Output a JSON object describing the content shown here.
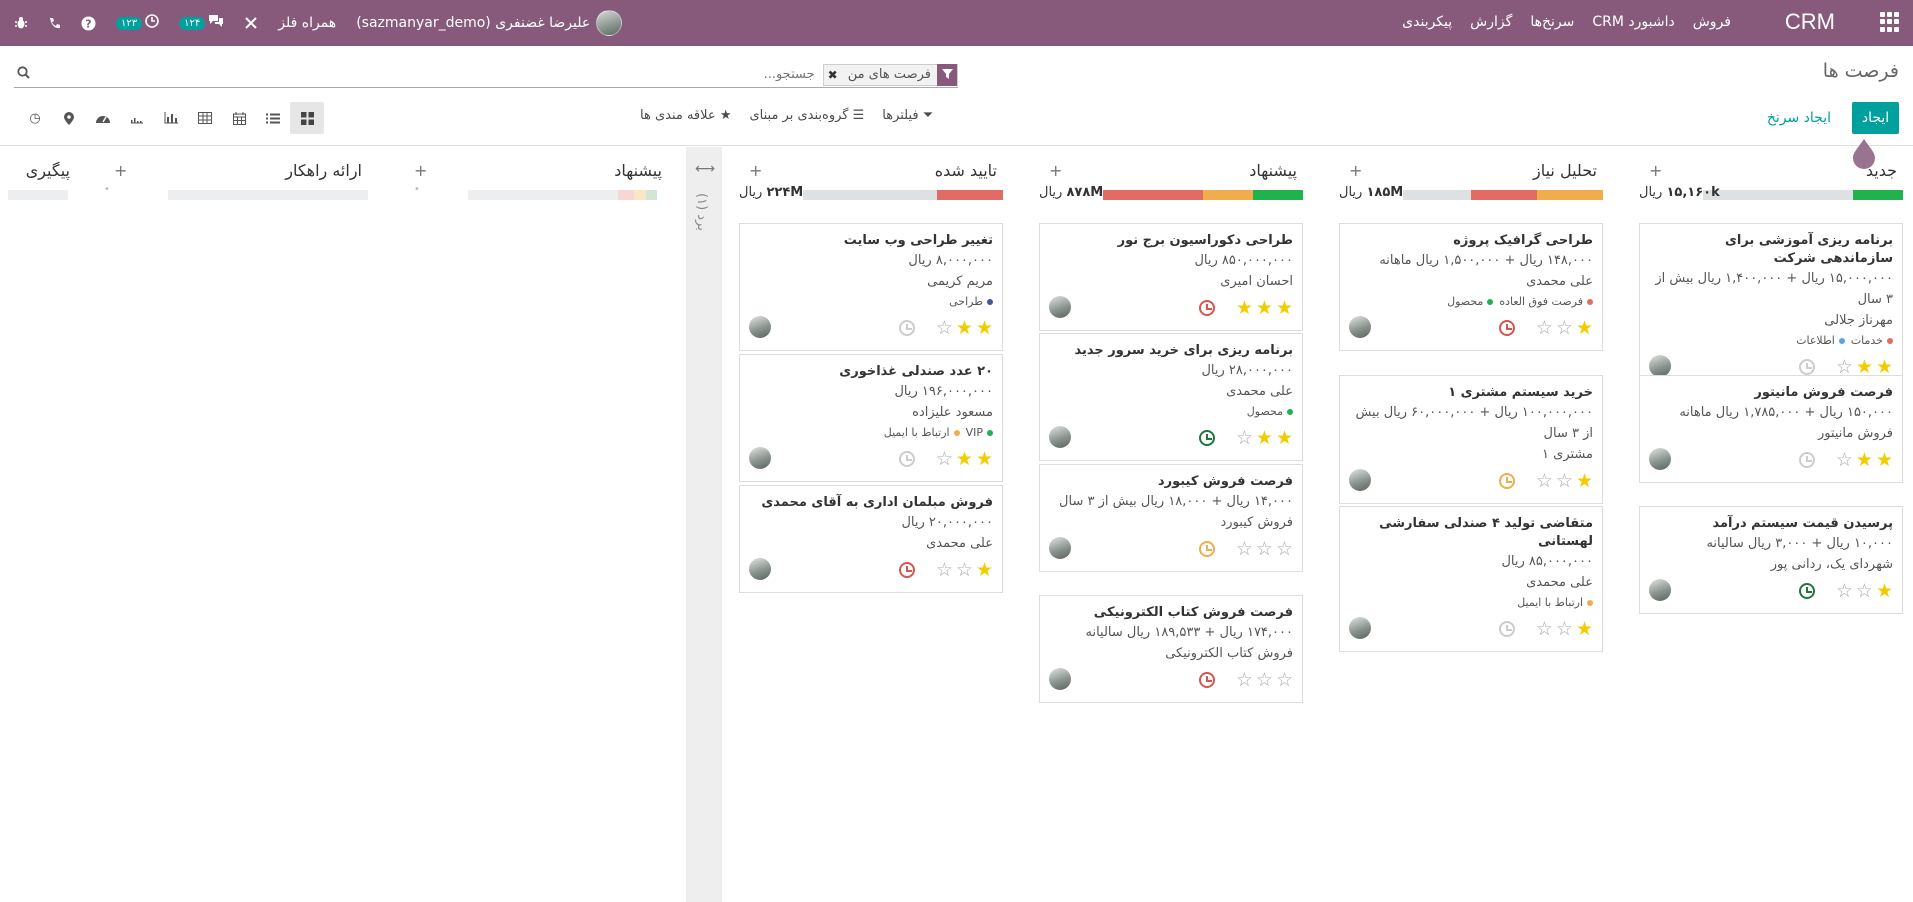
{
  "navbar": {
    "brand": "CRM",
    "menu": [
      "فروش",
      "داشبورد CRM",
      "سرنخ‌ها",
      "گزارش",
      "پیکربندی"
    ],
    "user": "علیرضا غضنفری (sazmanyar_demo)",
    "company": "همراه فلز",
    "messages_badge": "۱۲۴",
    "activities_badge": "۱۲۳"
  },
  "control": {
    "title": "فرصت ها",
    "facet": "فرصت های من",
    "search_placeholder": "جستجو...",
    "create": "ایجاد",
    "quick_create": "ایجاد سرنخ",
    "filters": "فیلترها",
    "group_by": "گروه‌بندی بر مبنای",
    "favorites": "علاقه مندی ها"
  },
  "colors": {
    "brand": "#875a7b",
    "accent": "#00a09d",
    "green": "#21b14d",
    "orange": "#f0ad4e",
    "red": "#e06c63",
    "grey": "#dde1e4"
  },
  "columns": [
    {
      "title": "جدید",
      "total_value": "۱۵,۱۶۰k",
      "total_unit": "ریال",
      "progress": {
        "green": 25,
        "orange": 0,
        "red": 0,
        "grey": 75
      },
      "cards": [
        {
          "title": "برنامه ریزی آموزشی برای سازماندهی شرکت",
          "lines": [
            "۱۵,۰۰۰,۰۰۰ ریال + ۱,۴۰۰,۰۰۰ ریال بیش از ۳ سال",
            "مهرناز جلالی"
          ],
          "tags": [
            {
              "label": "خدمات",
              "color": "#e06c63"
            },
            {
              "label": "اطلاعات",
              "color": "#5aa6dc"
            }
          ],
          "stars": 2,
          "clock": "#cccccc"
        },
        {
          "title": "فرصت فروش مانیتور",
          "lines": [
            "۱۵۰,۰۰۰ ریال + ۱,۷۸۵,۰۰۰ ریال ماهانه",
            "فروش مانیتور"
          ],
          "tags": [],
          "stars": 2,
          "clock": "#cccccc"
        },
        {
          "title": "پرسیدن قیمت سیستم درآمد",
          "lines": [
            "۱۰,۰۰۰ ریال + ۳,۰۰۰ ریال سالیانه",
            "شهردای یک، ردانی پور"
          ],
          "tags": [],
          "stars": 1,
          "clock": "#21763a"
        }
      ]
    },
    {
      "title": "تحلیل نیاز",
      "total_value": "۱۸۵M",
      "total_unit": "ریال",
      "progress": {
        "green": 0,
        "orange": 33,
        "red": 33,
        "grey": 34
      },
      "cards": [
        {
          "title": "طراحی گرافیک پروژه",
          "lines": [
            "۱۴۸,۰۰۰ ریال + ۱,۵۰۰,۰۰۰ ریال ماهانه",
            "علی محمدی"
          ],
          "tags": [
            {
              "label": "فرصت فوق العاده",
              "color": "#e06c63"
            },
            {
              "label": "محصول",
              "color": "#21b14d"
            }
          ],
          "stars": 1,
          "clock": "#d9534f"
        },
        {
          "title": "خرید سیستم مشتری ۱",
          "lines": [
            "۱۰۰,۰۰۰,۰۰۰ ریال + ۶۰,۰۰۰,۰۰۰ ریال بیش از ۳ سال",
            "مشتری ۱"
          ],
          "tags": [],
          "stars": 1,
          "clock": "#f0ad4e"
        },
        {
          "title": "متقاضی تولید ۴ صندلی سفارشی لهستانی",
          "lines": [
            "۸۵,۰۰۰,۰۰۰ ریال",
            "علی محمدی"
          ],
          "tags": [
            {
              "label": "ارتباط با ایمیل",
              "color": "#f0ad4e"
            }
          ],
          "stars": 1,
          "clock": "#cccccc"
        }
      ]
    },
    {
      "title": "پیشنهاد",
      "total_value": "۸۷۸M",
      "total_unit": "ریال",
      "progress": {
        "green": 25,
        "orange": 25,
        "red": 50,
        "grey": 0
      },
      "cards": [
        {
          "title": "طراحی دکوراسیون برج نور",
          "lines": [
            "۸۵۰,۰۰۰,۰۰۰ ریال",
            "احسان امیری"
          ],
          "tags": [],
          "stars": 3,
          "clock": "#d9534f"
        },
        {
          "title": "برنامه ریزی برای خرید سرور جدید",
          "lines": [
            "۲۸,۰۰۰,۰۰۰ ریال",
            "علی محمدی"
          ],
          "tags": [
            {
              "label": "محصول",
              "color": "#21b14d"
            }
          ],
          "stars": 2,
          "clock": "#21763a"
        },
        {
          "title": "فرصت فروش کیبورد",
          "lines": [
            "۱۴,۰۰۰ ریال + ۱۸,۰۰۰ ریال بیش از ۳ سال",
            "فروش کیبورد"
          ],
          "tags": [],
          "stars": 0,
          "clock": "#f0ad4e"
        },
        {
          "title": "فرصت فروش کتاب الکترونیکی",
          "lines": [
            "۱۷۴,۰۰۰ ریال + ۱۸۹,۵۳۳ ریال سالیانه",
            "فروش کتاب الکترونیکی"
          ],
          "tags": [],
          "stars": 0,
          "clock": "#d9534f"
        }
      ]
    },
    {
      "title": "تایید شده",
      "total_value": "۲۲۴M",
      "total_unit": "ریال",
      "progress": {
        "green": 0,
        "orange": 0,
        "red": 33,
        "grey": 67
      },
      "cards": [
        {
          "title": "تغییر طراحی وب سایت",
          "lines": [
            "۸,۰۰۰,۰۰۰ ریال",
            "مریم کریمی"
          ],
          "tags": [
            {
              "label": "طراحی",
              "color": "#3c5a9a"
            }
          ],
          "stars": 2,
          "clock": "#cccccc"
        },
        {
          "title": "۲۰ عدد صندلی غذاخوری",
          "lines": [
            "۱۹۶,۰۰۰,۰۰۰ ریال",
            "مسعود علیزاده"
          ],
          "tags": [
            {
              "label": "VIP",
              "color": "#21b14d"
            },
            {
              "label": "ارتباط با ایمیل",
              "color": "#f0ad4e"
            }
          ],
          "stars": 2,
          "clock": "#cccccc"
        },
        {
          "title": "فروش مبلمان اداری به آقای محمدی",
          "lines": [
            "۲۰,۰۰۰,۰۰۰ ریال",
            "علی محمدی"
          ],
          "tags": [],
          "stars": 1,
          "clock": "#d9534f"
        }
      ]
    }
  ],
  "folded": {
    "label": "برد (۱)"
  },
  "empty_columns": [
    {
      "title": "پیشنهاد"
    },
    {
      "title": "ارائه راهکار"
    },
    {
      "title": "پیگیری"
    }
  ]
}
